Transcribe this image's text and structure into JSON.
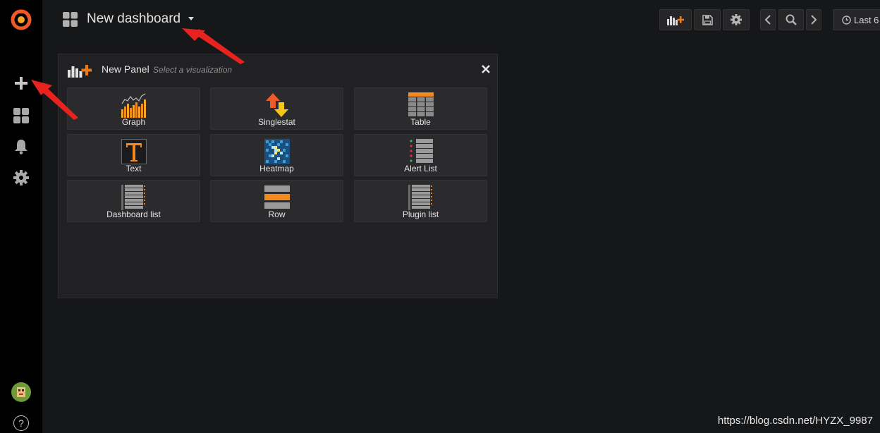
{
  "sidebar": {
    "logo": "grafana-logo",
    "items": [
      {
        "name": "plus-icon"
      },
      {
        "name": "dashboards-icon"
      },
      {
        "name": "bell-icon"
      },
      {
        "name": "gear-icon"
      }
    ],
    "help": "?"
  },
  "header": {
    "title": "New dashboard",
    "time_picker_label": "Last 6"
  },
  "panel": {
    "title": "New Panel",
    "subtitle": "Select a visualization",
    "visualizations": [
      {
        "label": "Graph",
        "icon": "graph-icon"
      },
      {
        "label": "Singlestat",
        "icon": "singlestat-icon"
      },
      {
        "label": "Table",
        "icon": "table-icon"
      },
      {
        "label": "Text",
        "icon": "text-icon"
      },
      {
        "label": "Heatmap",
        "icon": "heatmap-icon"
      },
      {
        "label": "Alert List",
        "icon": "alert-list-icon"
      },
      {
        "label": "Dashboard list",
        "icon": "dashboard-list-icon"
      },
      {
        "label": "Row",
        "icon": "row-icon"
      },
      {
        "label": "Plugin list",
        "icon": "plugin-list-icon"
      }
    ]
  },
  "watermark": "https://blog.csdn.net/HYZX_9987",
  "colors": {
    "accent": "#eb7b18",
    "background": "#161719",
    "sidebar": "#000000"
  }
}
